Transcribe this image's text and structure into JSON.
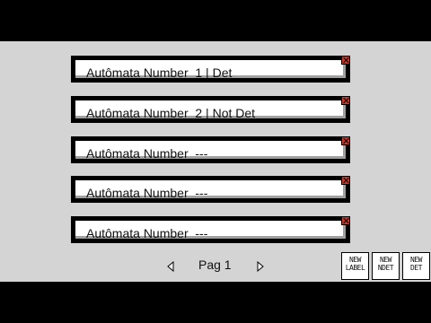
{
  "slots": [
    {
      "label": "Autômata Number  1 | Det"
    },
    {
      "label": "Autômata Number  2 | Not Det"
    },
    {
      "label": "Autômata Number  ---"
    },
    {
      "label": "Autômata Number  ---"
    },
    {
      "label": "Autômata Number  ---"
    }
  ],
  "pager": {
    "label": "Pag 1",
    "prev_icon": "arrow-left-icon",
    "next_icon": "arrow-right-icon"
  },
  "tools": [
    {
      "line1": "NEW",
      "line2": "LABEL"
    },
    {
      "line1": "NEW",
      "line2": "NDET"
    },
    {
      "line1": "NEW",
      "line2": "DET"
    }
  ],
  "colors": {
    "background": "#d4d4d4",
    "close": "#c0392b",
    "frame": "#000000"
  }
}
